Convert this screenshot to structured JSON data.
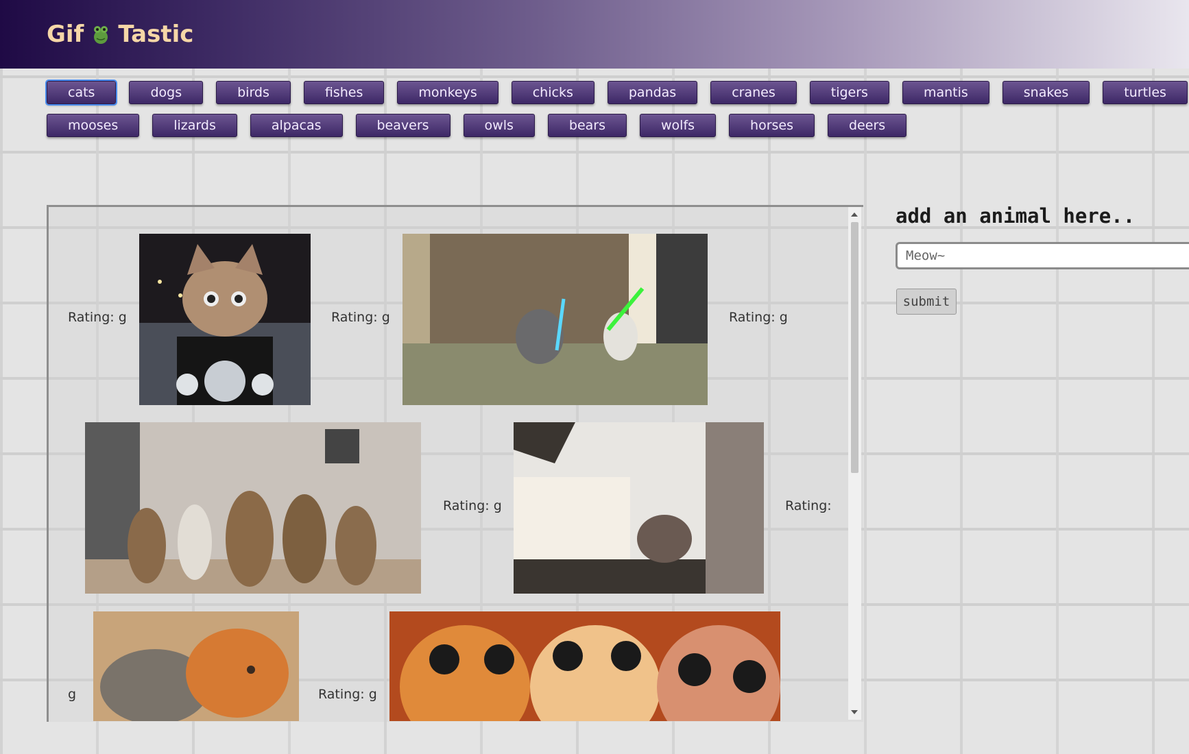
{
  "header": {
    "title_left": "Gif",
    "title_right": "Tastic"
  },
  "buttons": {
    "row1": [
      "cats",
      "dogs",
      "birds",
      "fishes",
      "monkeys",
      "chicks",
      "pandas",
      "cranes",
      "tigers",
      "mantis",
      "snakes",
      "turtles"
    ],
    "row2": [
      "mooses",
      "lizards",
      "alpacas",
      "beavers",
      "owls",
      "bears",
      "wolfs",
      "horses",
      "deers"
    ],
    "active": "cats"
  },
  "gifs": {
    "ratings": [
      "Rating: g",
      "Rating: g",
      "Rating: g",
      "Rating: g",
      "Rating:",
      "g",
      "Rating: g"
    ]
  },
  "sidebar": {
    "title": "add an animal here..",
    "input_placeholder": "Meow~",
    "submit_label": "submit"
  },
  "colors": {
    "header_start": "#1f0a45",
    "button": "#4e3a7a",
    "brand_text": "#f6d7a7"
  }
}
